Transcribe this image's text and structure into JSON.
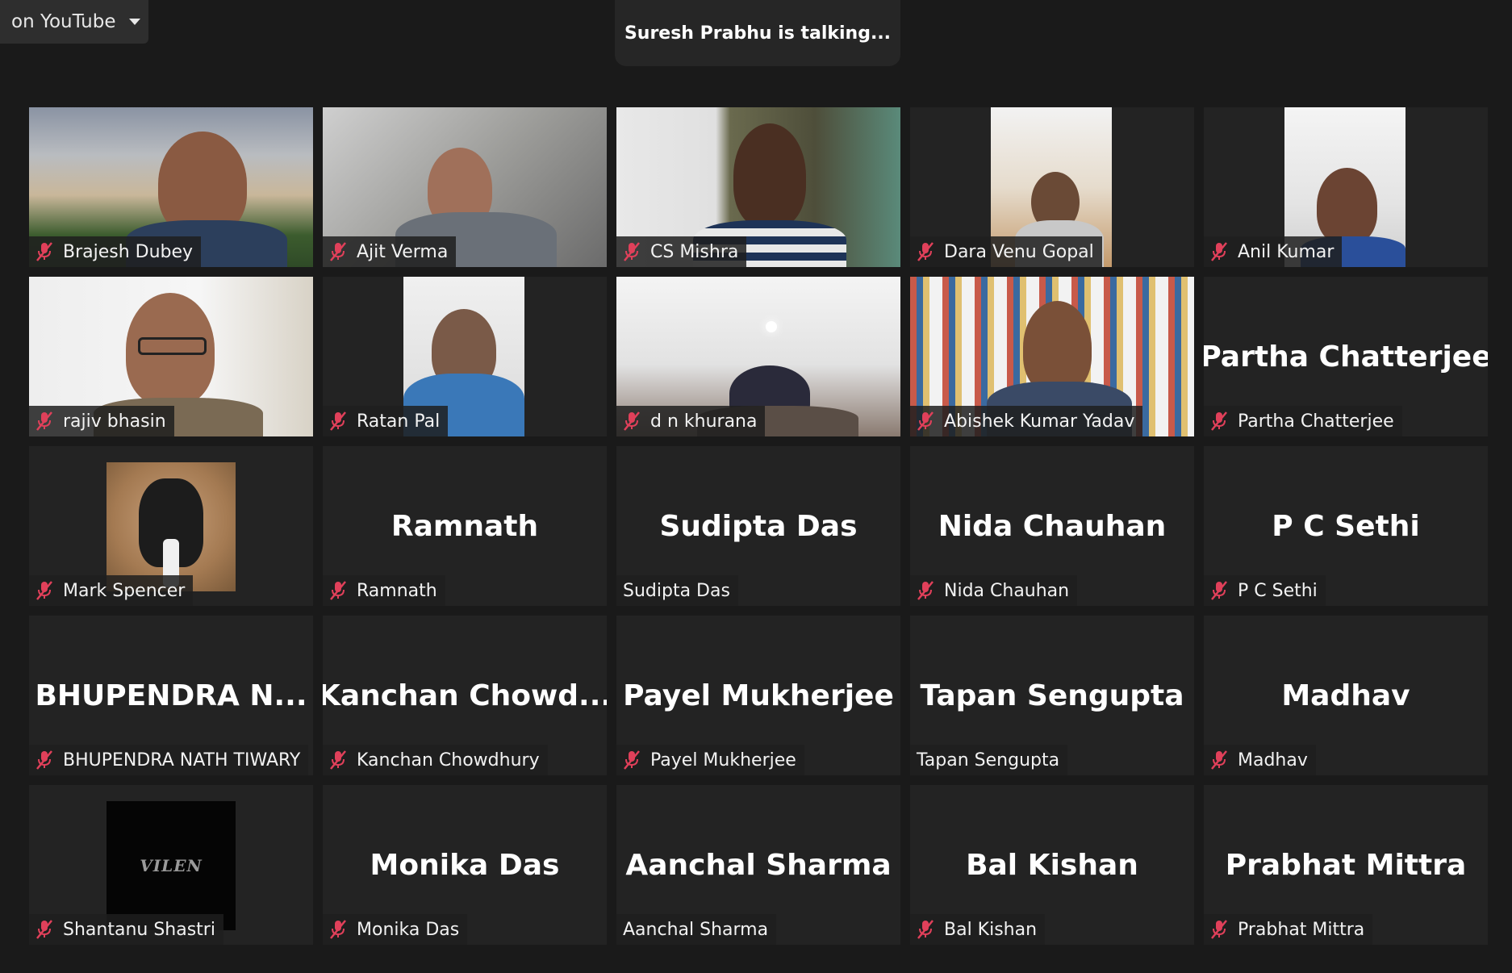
{
  "stream_button": {
    "label": "on YouTube"
  },
  "speaker_banner": {
    "text": "Suresh Prabhu is talking..."
  },
  "colors": {
    "mute_icon": "#e0405a",
    "tile_bg": "#232323",
    "app_bg": "#1a1a1a"
  },
  "participants": [
    {
      "name": "Brajesh Dubey",
      "muted": true,
      "video": true,
      "big_name": ""
    },
    {
      "name": "Ajit Verma",
      "muted": true,
      "video": true,
      "big_name": ""
    },
    {
      "name": "CS Mishra",
      "muted": true,
      "video": true,
      "big_name": ""
    },
    {
      "name": "Dara Venu Gopal",
      "muted": true,
      "video": true,
      "big_name": ""
    },
    {
      "name": "Anil Kumar",
      "muted": true,
      "video": true,
      "big_name": ""
    },
    {
      "name": "rajiv bhasin",
      "muted": true,
      "video": true,
      "big_name": ""
    },
    {
      "name": "Ratan Pal",
      "muted": true,
      "video": true,
      "big_name": ""
    },
    {
      "name": "d n khurana",
      "muted": true,
      "video": true,
      "big_name": ""
    },
    {
      "name": "Abishek Kumar Yadav",
      "muted": true,
      "video": true,
      "big_name": ""
    },
    {
      "name": "Partha Chatterjee",
      "muted": true,
      "video": false,
      "big_name": "Partha Chatterjee"
    },
    {
      "name": "Mark Spencer",
      "muted": true,
      "video": false,
      "big_name": ""
    },
    {
      "name": "Ramnath",
      "muted": true,
      "video": false,
      "big_name": "Ramnath"
    },
    {
      "name": "Sudipta Das",
      "muted": false,
      "video": false,
      "big_name": "Sudipta Das"
    },
    {
      "name": "Nida Chauhan",
      "muted": true,
      "video": false,
      "big_name": "Nida Chauhan"
    },
    {
      "name": "P C Sethi",
      "muted": true,
      "video": false,
      "big_name": "P C Sethi"
    },
    {
      "name": "BHUPENDRA NATH TIWARY",
      "muted": true,
      "video": false,
      "big_name": "BHUPENDRA  N..."
    },
    {
      "name": "Kanchan Chowdhury",
      "muted": true,
      "video": false,
      "big_name": "Kanchan  Chowd..."
    },
    {
      "name": "Payel Mukherjee",
      "muted": true,
      "video": false,
      "big_name": "Payel Mukherjee"
    },
    {
      "name": "Tapan Sengupta",
      "muted": false,
      "video": false,
      "big_name": "Tapan Sengupta"
    },
    {
      "name": "Madhav",
      "muted": true,
      "video": false,
      "big_name": "Madhav"
    },
    {
      "name": "Shantanu Shastri",
      "muted": true,
      "video": false,
      "big_name": "",
      "avatar_text": "VILEN"
    },
    {
      "name": "Monika Das",
      "muted": true,
      "video": false,
      "big_name": "Monika Das"
    },
    {
      "name": "Aanchal Sharma",
      "muted": false,
      "video": false,
      "big_name": "Aanchal Sharma"
    },
    {
      "name": "Bal Kishan",
      "muted": true,
      "video": false,
      "big_name": "Bal Kishan"
    },
    {
      "name": "Prabhat Mittra",
      "muted": true,
      "video": false,
      "big_name": "Prabhat Mittra"
    }
  ]
}
